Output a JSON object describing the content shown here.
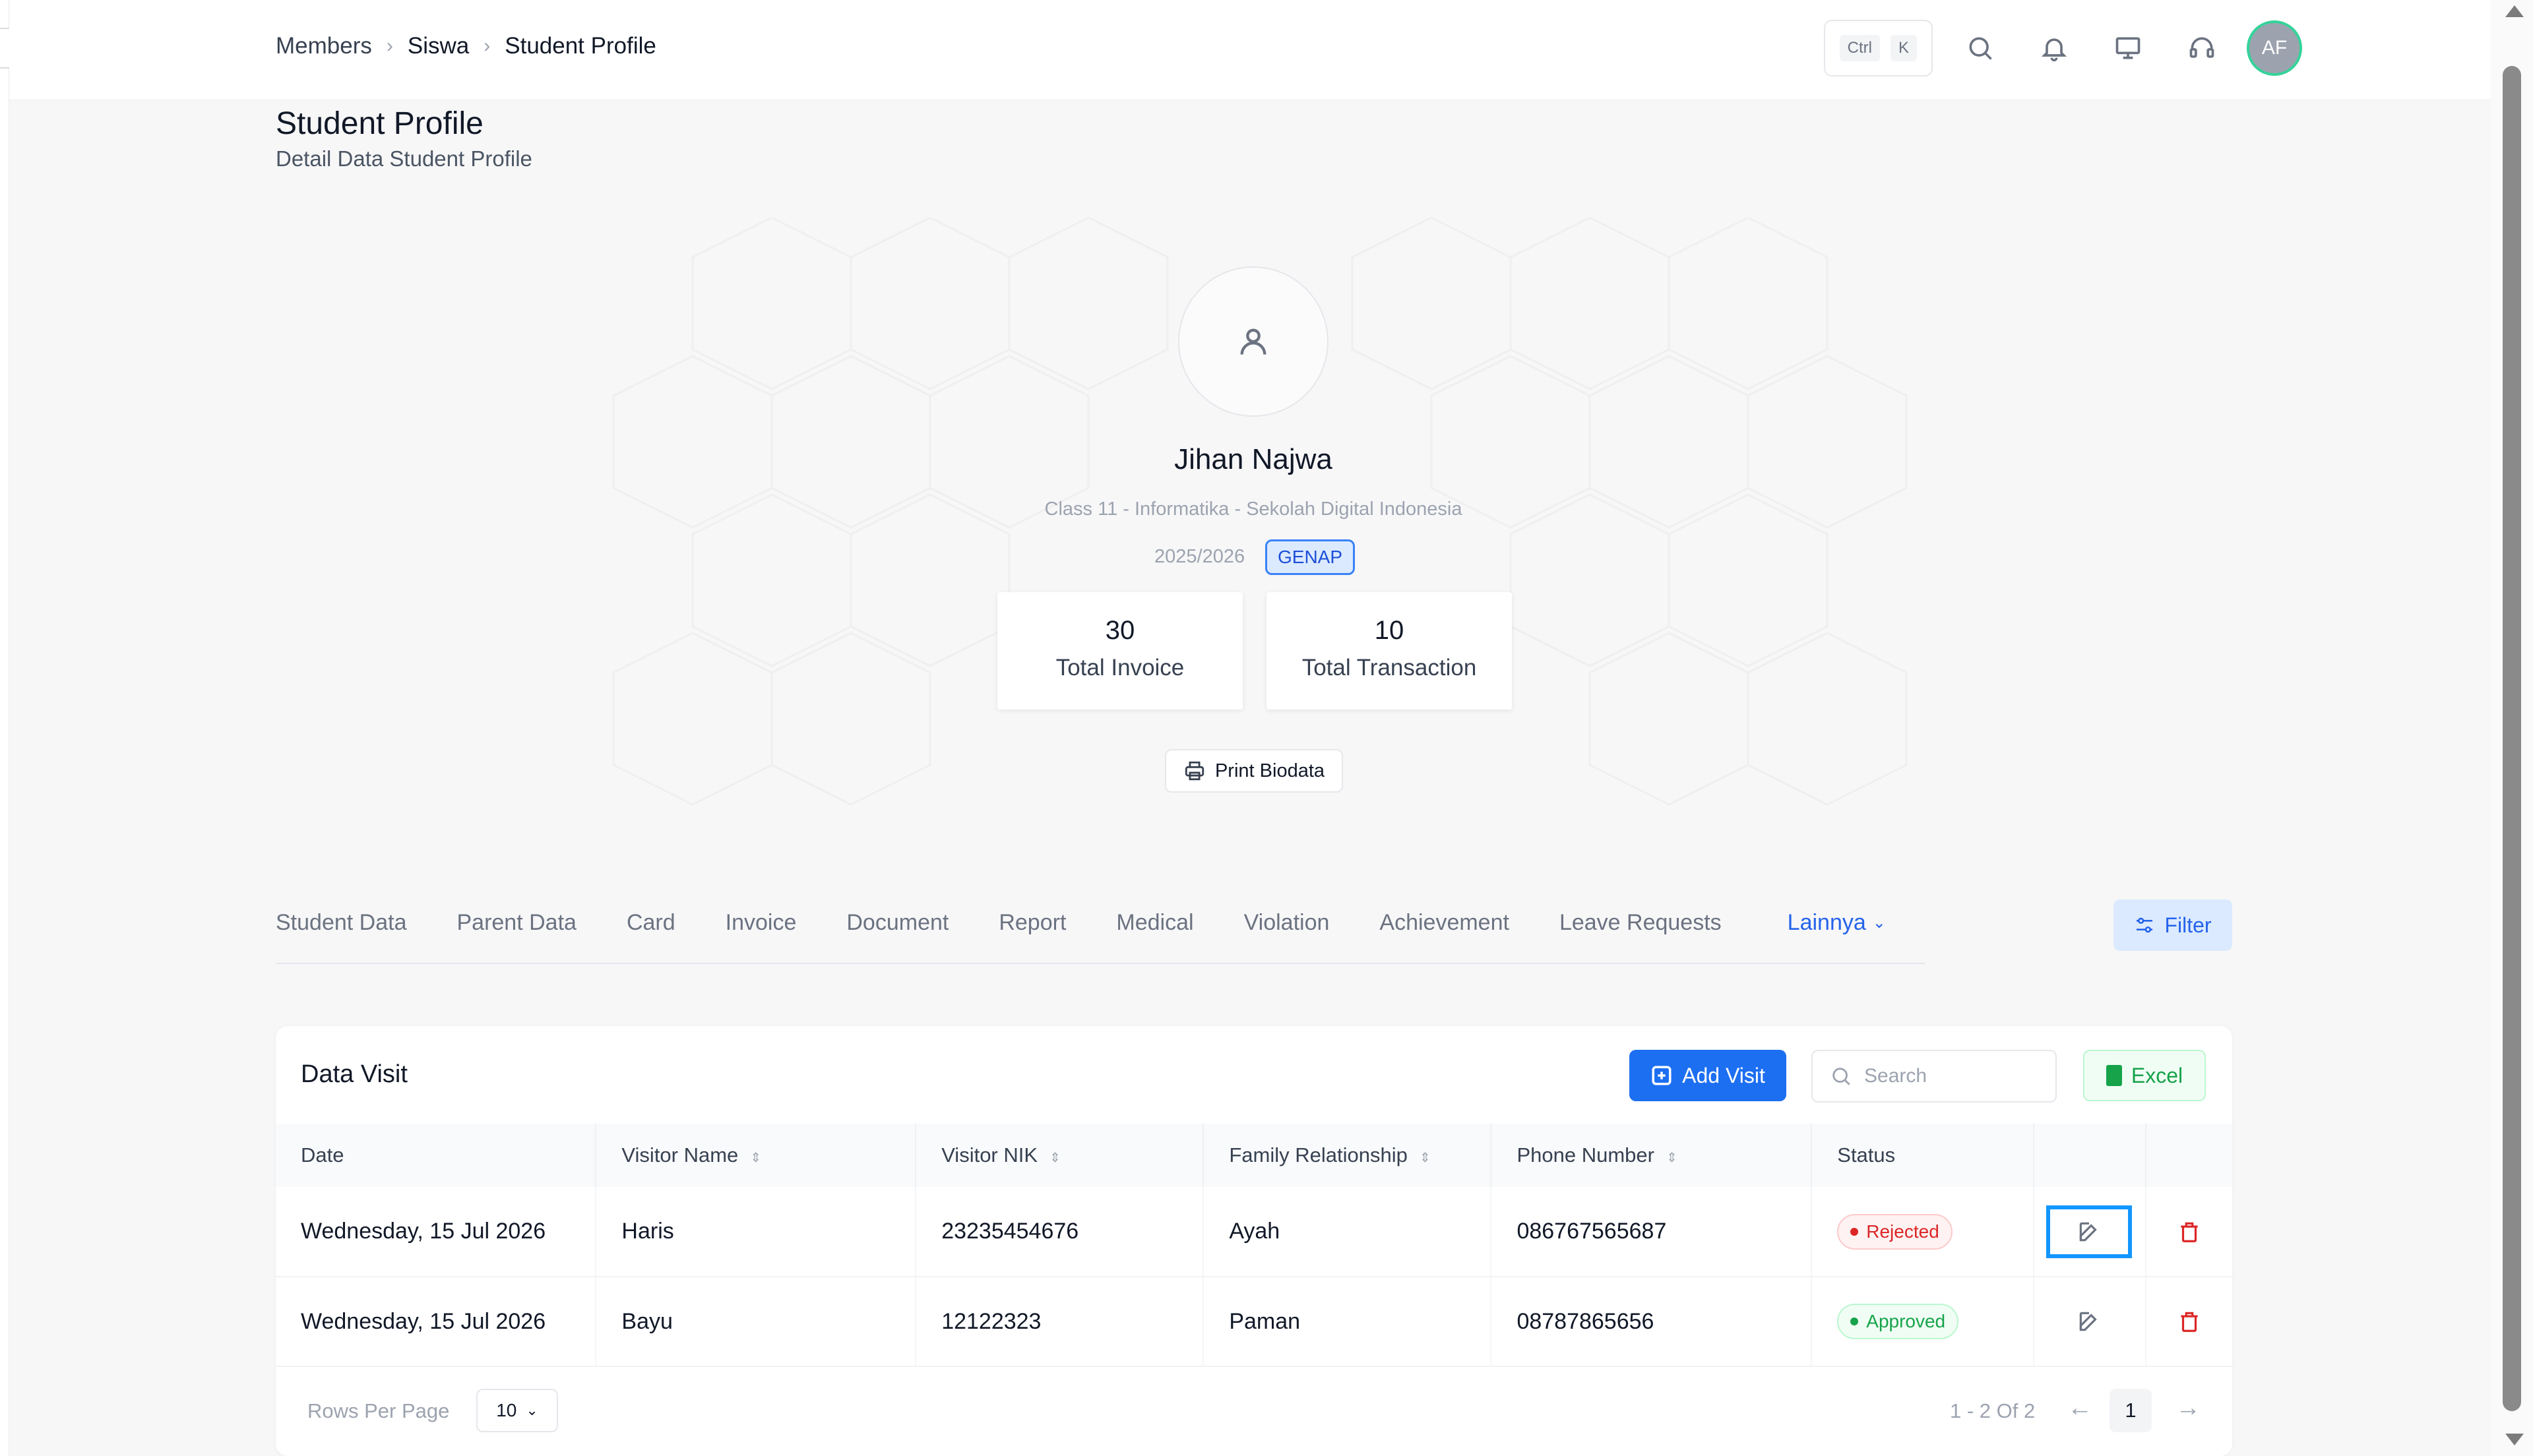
{
  "breadcrumb": {
    "items": [
      "Members",
      "Siswa",
      "Student Profile"
    ]
  },
  "shortcut": {
    "key1": "Ctrl",
    "key2": "K"
  },
  "user": {
    "initials": "AF"
  },
  "page": {
    "title": "Student Profile",
    "subtitle": "Detail Data Student Profile"
  },
  "profile": {
    "name": "Jihan Najwa",
    "class_line": "Class 11 - Informatika - Sekolah Digital Indonesia",
    "year": "2025/2026",
    "semester": "GENAP",
    "stats": [
      {
        "value": "30",
        "label": "Total Invoice"
      },
      {
        "value": "10",
        "label": "Total Transaction"
      }
    ],
    "print_label": "Print Biodata"
  },
  "tabs": [
    "Student Data",
    "Parent Data",
    "Card",
    "Invoice",
    "Document",
    "Report",
    "Medical",
    "Violation",
    "Achievement",
    "Leave Requests"
  ],
  "tab_more": "Lainnya",
  "filter_label": "Filter",
  "visit": {
    "title": "Data Visit",
    "add_label": "Add Visit",
    "search_placeholder": "Search",
    "excel_label": "Excel",
    "columns": [
      "Date",
      "Visitor Name",
      "Visitor NIK",
      "Family Relationship",
      "Phone Number",
      "Status"
    ],
    "rows": [
      {
        "date": "Wednesday, 15 Jul 2026",
        "name": "Haris",
        "nik": "23235454676",
        "relation": "Ayah",
        "phone": "086767565687",
        "status": "Rejected"
      },
      {
        "date": "Wednesday, 15 Jul 2026",
        "name": "Bayu",
        "nik": "12122323",
        "relation": "Paman",
        "phone": "08787865656",
        "status": "Approved"
      }
    ],
    "rows_per_page_label": "Rows Per Page",
    "rows_per_page": "10",
    "page_info": "1 - 2 Of 2",
    "current_page": "1"
  },
  "colors": {
    "accent": "#1d6ff2",
    "rejected": "#dc2626",
    "approved": "#16a34a",
    "focus": "#1296ff"
  }
}
